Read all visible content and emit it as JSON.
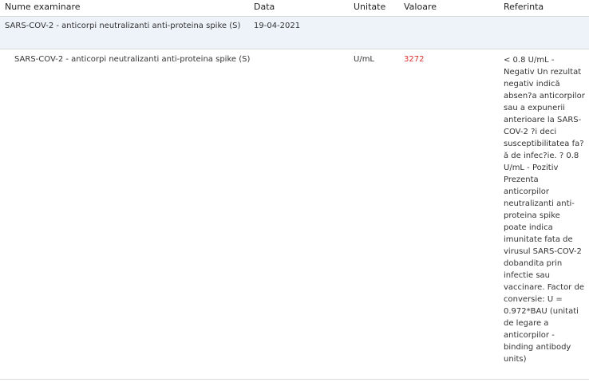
{
  "table": {
    "headers": {
      "name": "Nume examinare",
      "date": "Data",
      "unit": "Unitate",
      "value": "Valoare",
      "reference": "Referinta"
    },
    "group": {
      "name": "SARS-COV-2 - anticorpi neutralizanti anti-proteina spike (S)",
      "date": "19-04-2021"
    },
    "test": {
      "name": "SARS-COV-2 - anticorpi neutralizanti anti-proteina spike (S)",
      "unit": "U/mL",
      "value": "3272",
      "reference": "< 0.8 U/mL - Negativ Un rezultat negativ indică absen?a anticorpilor sau a expunerii anterioare la SARS-COV-2 ?i deci susceptibilitatea fa?ă de infec?ie. ? 0.8 U/mL - Pozitiv Prezenta anticorpilor neutralizanti anti-proteina spike poate indica imunitate fata de virusul SARS-COV-2 dobandita prin infectie sau vaccinare. Factor de conversie: U = 0.972*BAU (unitati de legare a anticorpilor - binding antibody units)"
    },
    "colors": {
      "abnormal_value": "#d9312b",
      "group_background": "#eef3fa"
    }
  }
}
